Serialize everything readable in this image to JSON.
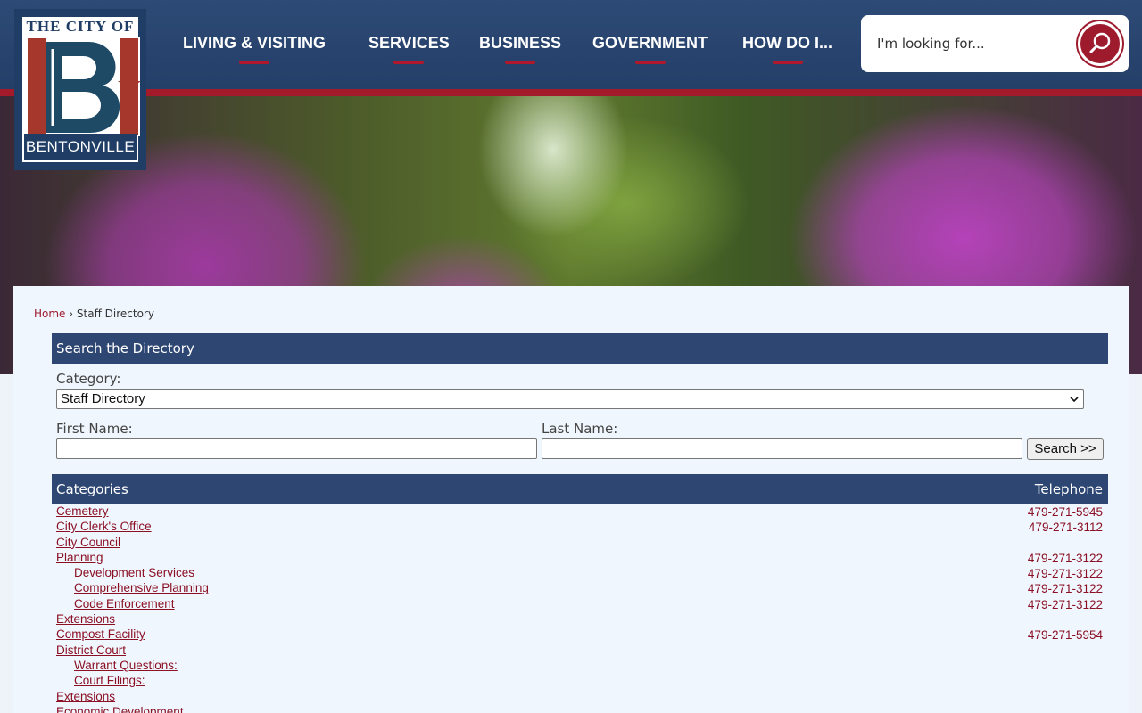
{
  "logo": {
    "top_text": "THE CITY OF",
    "bottom_text": "BENTONVILLE"
  },
  "nav": [
    {
      "label": "LIVING & VISITING"
    },
    {
      "label": "SERVICES"
    },
    {
      "label": "BUSINESS"
    },
    {
      "label": "GOVERNMENT"
    },
    {
      "label": "HOW DO I..."
    }
  ],
  "search": {
    "placeholder": "I'm looking for...",
    "icon": "search-icon"
  },
  "breadcrumb": {
    "home": "Home",
    "separator": "›",
    "current": "Staff Directory"
  },
  "directory_search": {
    "heading": "Search the Directory",
    "category_label": "Category:",
    "category_value": "Staff Directory",
    "first_name_label": "First Name:",
    "last_name_label": "Last Name:",
    "search_button": "Search >>"
  },
  "categories_table": {
    "header_left": "Categories",
    "header_right": "Telephone",
    "rows": [
      {
        "name": "Cemetery",
        "phone": "479-271-5945",
        "indent": false
      },
      {
        "name": "City Clerk's Office",
        "phone": "479-271-3112",
        "indent": false
      },
      {
        "name": "City Council",
        "phone": "",
        "indent": false
      },
      {
        "name": "Planning",
        "phone": "479-271-3122",
        "indent": false
      },
      {
        "name": "Development Services",
        "phone": "479-271-3122",
        "indent": true
      },
      {
        "name": "Comprehensive Planning",
        "phone": "479-271-3122",
        "indent": true
      },
      {
        "name": "Code Enforcement",
        "phone": "479-271-3122",
        "indent": true
      },
      {
        "name": "Extensions",
        "phone": "",
        "indent": false
      },
      {
        "name": "Compost Facility",
        "phone": "479-271-5954",
        "indent": false
      },
      {
        "name": "District Court",
        "phone": "",
        "indent": false
      },
      {
        "name": "Warrant Questions:",
        "phone": "",
        "indent": true
      },
      {
        "name": "Court Filings:",
        "phone": "",
        "indent": true
      },
      {
        "name": "Extensions",
        "phone": "",
        "indent": false
      },
      {
        "name": "Economic Development",
        "phone": "",
        "indent": false
      }
    ]
  },
  "colors": {
    "navy": "#2d4672",
    "brand_red": "#9e1b2e",
    "link": "#8b1024"
  }
}
